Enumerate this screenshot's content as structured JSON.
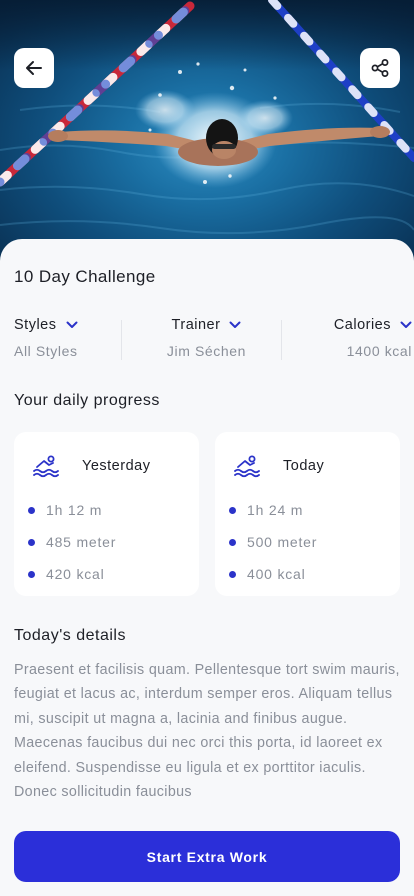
{
  "header": {
    "back_icon": "arrow-left-icon",
    "share_icon": "share-icon",
    "hero_image": "swimmer-butterfly-stroke-photo"
  },
  "challenge": {
    "title": "10 Day Challenge"
  },
  "filters": [
    {
      "label": "Styles",
      "value": "All Styles"
    },
    {
      "label": "Trainer",
      "value": "Jim Séchen"
    },
    {
      "label": "Calories",
      "value": "1400 kcal"
    }
  ],
  "progress": {
    "title": "Your daily progress",
    "cards": [
      {
        "title": "Yesterday",
        "icon": "swimmer-icon",
        "stats": [
          "1h 12 m",
          "485 meter",
          "420 kcal"
        ]
      },
      {
        "title": "Today",
        "icon": "swimmer-icon",
        "stats": [
          "1h 24 m",
          "500 meter",
          "400 kcal"
        ]
      }
    ]
  },
  "details": {
    "title": "Today's details",
    "body": "Praesent et facilisis quam. Pellentesque tort swim mauris, feugiat et lacus ac, interdum semper eros. Aliquam tellus mi, suscipit ut magna a, lacinia and finibus augue. Maecenas faucibus dui nec orci this porta, id laoreet ex eleifend. Suspendisse eu ligula et ex porttitor iaculis. Donec sollicitudin faucibus"
  },
  "cta": {
    "label": "Start Extra Work"
  },
  "colors": {
    "accent": "#2b2fd9",
    "dot": "#2b33c9",
    "muted_text": "#8a8f99",
    "background": "#f7f8fa"
  }
}
